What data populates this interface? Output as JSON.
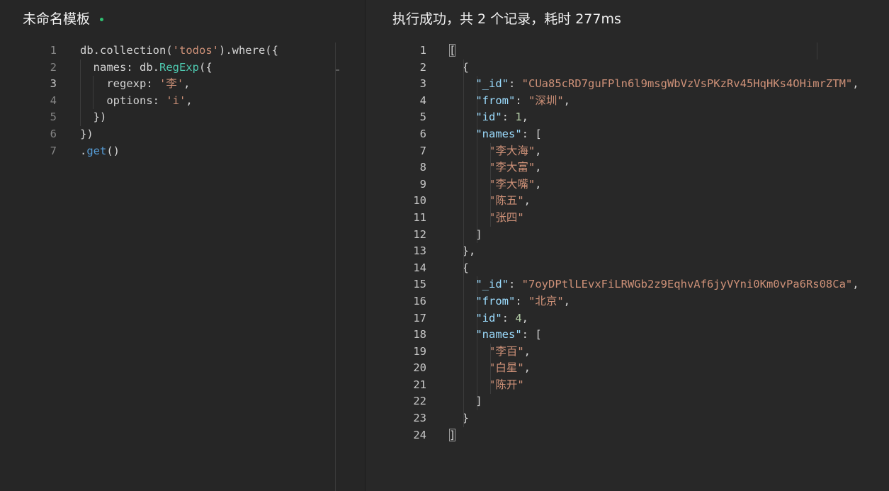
{
  "left": {
    "title": "未命名模板",
    "lines": [
      {
        "n": "1",
        "tokens": [
          [
            "plain",
            "db.collection("
          ],
          [
            "str",
            "'todos'"
          ],
          [
            "plain",
            ").where({"
          ]
        ]
      },
      {
        "n": "2",
        "tokens": [
          [
            "plain",
            "  names: db."
          ],
          [
            "fn",
            "RegExp"
          ],
          [
            "plain",
            "({"
          ]
        ]
      },
      {
        "n": "3",
        "tokens": [
          [
            "plain",
            "    regexp: "
          ],
          [
            "str",
            "'李'"
          ],
          [
            "plain",
            ","
          ]
        ]
      },
      {
        "n": "4",
        "tokens": [
          [
            "plain",
            "    options: "
          ],
          [
            "str",
            "'i'"
          ],
          [
            "plain",
            ","
          ]
        ]
      },
      {
        "n": "5",
        "tokens": [
          [
            "plain",
            "  })"
          ]
        ]
      },
      {
        "n": "6",
        "tokens": [
          [
            "plain",
            "})"
          ]
        ]
      },
      {
        "n": "7",
        "tokens": [
          [
            "plain",
            "."
          ],
          [
            "method",
            "get"
          ],
          [
            "plain",
            "()"
          ]
        ]
      }
    ]
  },
  "right": {
    "title": "执行成功，共 2 个记录，耗时 277ms",
    "lines": [
      {
        "n": "1",
        "tokens": [
          [
            "bracket",
            "["
          ]
        ]
      },
      {
        "n": "2",
        "tokens": [
          [
            "plain",
            "  {"
          ]
        ]
      },
      {
        "n": "3",
        "tokens": [
          [
            "plain",
            "    "
          ],
          [
            "key",
            "\"_id\""
          ],
          [
            "plain",
            ": "
          ],
          [
            "str",
            "\"CUa85cRD7guFPln6l9msgWbVzVsPKzRv45HqHKs4OHimrZTM\""
          ],
          [
            "plain",
            ","
          ]
        ]
      },
      {
        "n": "4",
        "tokens": [
          [
            "plain",
            "    "
          ],
          [
            "key",
            "\"from\""
          ],
          [
            "plain",
            ": "
          ],
          [
            "str",
            "\"深圳\""
          ],
          [
            "plain",
            ","
          ]
        ]
      },
      {
        "n": "5",
        "tokens": [
          [
            "plain",
            "    "
          ],
          [
            "key",
            "\"id\""
          ],
          [
            "plain",
            ": "
          ],
          [
            "num",
            "1"
          ],
          [
            "plain",
            ","
          ]
        ]
      },
      {
        "n": "6",
        "tokens": [
          [
            "plain",
            "    "
          ],
          [
            "key",
            "\"names\""
          ],
          [
            "plain",
            ": ["
          ]
        ]
      },
      {
        "n": "7",
        "tokens": [
          [
            "plain",
            "      "
          ],
          [
            "str",
            "\"李大海\""
          ],
          [
            "plain",
            ","
          ]
        ]
      },
      {
        "n": "8",
        "tokens": [
          [
            "plain",
            "      "
          ],
          [
            "str",
            "\"李大富\""
          ],
          [
            "plain",
            ","
          ]
        ]
      },
      {
        "n": "9",
        "tokens": [
          [
            "plain",
            "      "
          ],
          [
            "str",
            "\"李大嘴\""
          ],
          [
            "plain",
            ","
          ]
        ]
      },
      {
        "n": "10",
        "tokens": [
          [
            "plain",
            "      "
          ],
          [
            "str",
            "\"陈五\""
          ],
          [
            "plain",
            ","
          ]
        ]
      },
      {
        "n": "11",
        "tokens": [
          [
            "plain",
            "      "
          ],
          [
            "str",
            "\"张四\""
          ]
        ]
      },
      {
        "n": "12",
        "tokens": [
          [
            "plain",
            "    ]"
          ]
        ]
      },
      {
        "n": "13",
        "tokens": [
          [
            "plain",
            "  },"
          ]
        ]
      },
      {
        "n": "14",
        "tokens": [
          [
            "plain",
            "  {"
          ]
        ]
      },
      {
        "n": "15",
        "tokens": [
          [
            "plain",
            "    "
          ],
          [
            "key",
            "\"_id\""
          ],
          [
            "plain",
            ": "
          ],
          [
            "str",
            "\"7oyDPtlLEvxFiLRWGb2z9EqhvAf6jyVYni0Km0vPa6Rs08Ca\""
          ],
          [
            "plain",
            ","
          ]
        ]
      },
      {
        "n": "16",
        "tokens": [
          [
            "plain",
            "    "
          ],
          [
            "key",
            "\"from\""
          ],
          [
            "plain",
            ": "
          ],
          [
            "str",
            "\"北京\""
          ],
          [
            "plain",
            ","
          ]
        ]
      },
      {
        "n": "17",
        "tokens": [
          [
            "plain",
            "    "
          ],
          [
            "key",
            "\"id\""
          ],
          [
            "plain",
            ": "
          ],
          [
            "num",
            "4"
          ],
          [
            "plain",
            ","
          ]
        ]
      },
      {
        "n": "18",
        "tokens": [
          [
            "plain",
            "    "
          ],
          [
            "key",
            "\"names\""
          ],
          [
            "plain",
            ": ["
          ]
        ]
      },
      {
        "n": "19",
        "tokens": [
          [
            "plain",
            "      "
          ],
          [
            "str",
            "\"李百\""
          ],
          [
            "plain",
            ","
          ]
        ]
      },
      {
        "n": "20",
        "tokens": [
          [
            "plain",
            "      "
          ],
          [
            "str",
            "\"白星\""
          ],
          [
            "plain",
            ","
          ]
        ]
      },
      {
        "n": "21",
        "tokens": [
          [
            "plain",
            "      "
          ],
          [
            "str",
            "\"陈开\""
          ]
        ]
      },
      {
        "n": "22",
        "tokens": [
          [
            "plain",
            "    ]"
          ]
        ]
      },
      {
        "n": "23",
        "tokens": [
          [
            "plain",
            "  }"
          ]
        ]
      },
      {
        "n": "24",
        "tokens": [
          [
            "bracket",
            "]"
          ]
        ]
      }
    ]
  },
  "colors": {
    "string": "#ce9178",
    "key": "#9cdcfe",
    "number": "#b5cea8",
    "class": "#4ec9b0",
    "method": "#569cd6",
    "dirty_indicator": "#2fbf71"
  }
}
